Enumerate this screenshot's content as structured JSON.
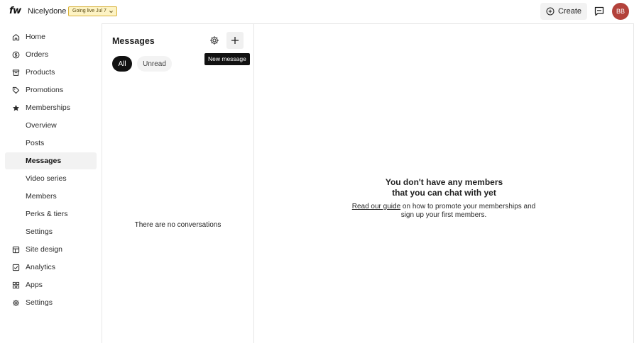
{
  "topbar": {
    "logo_text": "fw",
    "site_name": "Nicelydone",
    "live_badge": "Going live Jul 7",
    "create_label": "Create",
    "avatar_initials": "BB",
    "avatar_color": "#b3423b"
  },
  "sidebar": {
    "items": [
      {
        "label": "Home",
        "icon": "home-icon"
      },
      {
        "label": "Orders",
        "icon": "dollar-circle-icon"
      },
      {
        "label": "Products",
        "icon": "box-icon"
      },
      {
        "label": "Promotions",
        "icon": "tag-icon"
      },
      {
        "label": "Memberships",
        "icon": "star-icon"
      },
      {
        "label": "Overview"
      },
      {
        "label": "Posts"
      },
      {
        "label": "Messages",
        "active": true
      },
      {
        "label": "Video series"
      },
      {
        "label": "Members"
      },
      {
        "label": "Perks & tiers"
      },
      {
        "label": "Settings"
      },
      {
        "label": "Site design",
        "icon": "layout-icon"
      },
      {
        "label": "Analytics",
        "icon": "chart-check-icon"
      },
      {
        "label": "Apps",
        "icon": "grid-icon"
      },
      {
        "label": "Settings",
        "icon": "gear-icon"
      }
    ]
  },
  "messages": {
    "title": "Messages",
    "tooltip": "New message",
    "tabs": [
      {
        "label": "All",
        "selected": true
      },
      {
        "label": "Unread",
        "selected": false
      }
    ],
    "empty_text": "There are no conversations"
  },
  "main": {
    "empty_title_line1": "You don't have any members",
    "empty_title_line2": "that you can chat with yet",
    "guide_link": "Read our guide",
    "desc_rest": " on how to promote your memberships and sign up your first members."
  }
}
